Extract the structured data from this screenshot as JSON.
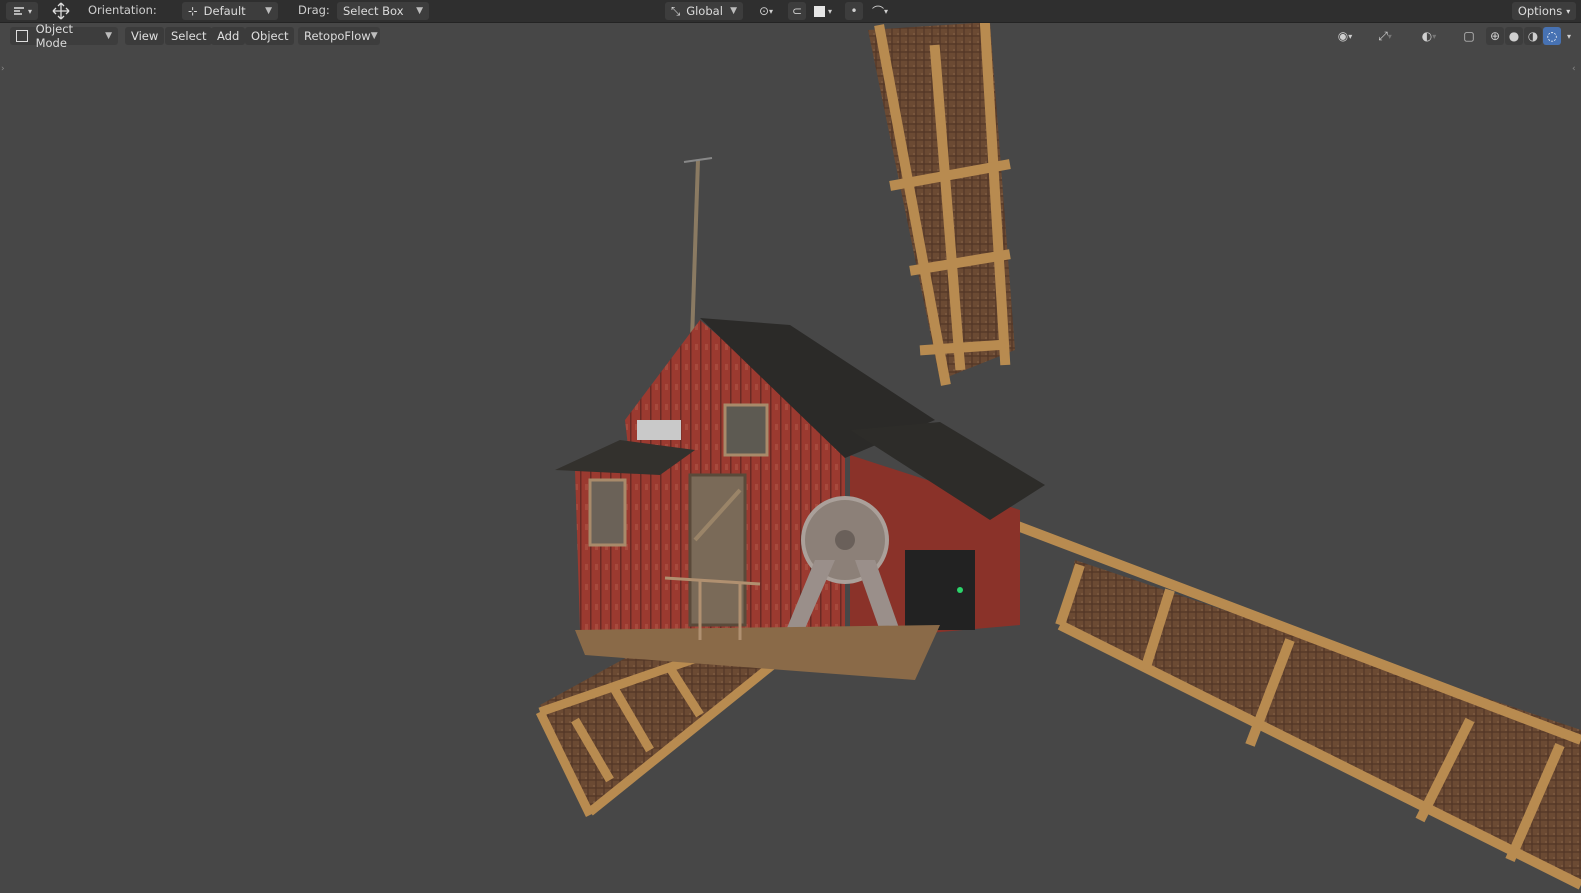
{
  "toolbar": {
    "orientation_label": "Orientation:",
    "orientation_value": "Default",
    "drag_label": "Drag:",
    "drag_value": "Select Box",
    "transform_space": "Global",
    "options_label": "Options"
  },
  "header": {
    "mode": "Object Mode",
    "menus": [
      "View",
      "Select",
      "Add",
      "Object"
    ],
    "addon": "RetopoFlow"
  },
  "icons": {
    "editor_type": "tool-settings-icon",
    "move": "move-arrows-icon",
    "orientation": "axis-orientation-icon",
    "transform": "transform-space-icon",
    "pivot": "pivot-point-icon",
    "snap": "snap-magnet-icon",
    "snap_target": "snap-target-icon",
    "proportional": "proportional-edit-icon",
    "falloff": "falloff-curve-icon",
    "mode": "object-mode-icon",
    "visibility": "eye-visibility-icon",
    "gizmo": "gizmo-icon",
    "overlays": "overlays-icon",
    "xray": "xray-icon",
    "wireframe": "wireframe-shading-icon",
    "solid": "solid-shading-icon",
    "material": "material-preview-icon",
    "rendered": "rendered-shading-icon"
  },
  "viewport": {
    "background": "#474747",
    "shading_active": "rendered",
    "accent": "#4772b3"
  }
}
